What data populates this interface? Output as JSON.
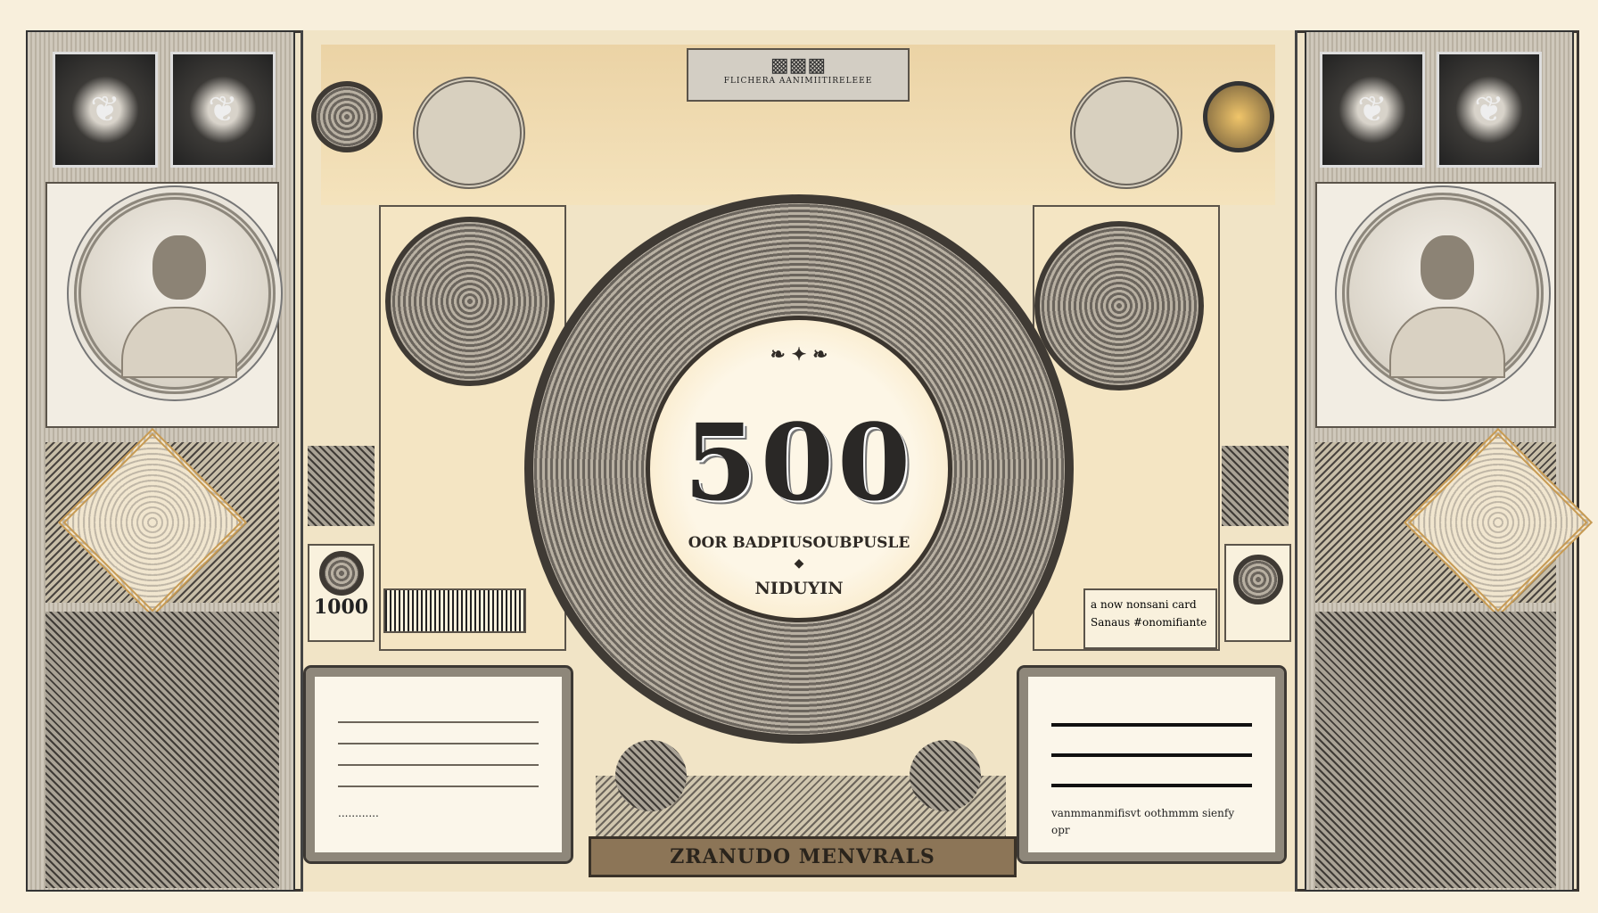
{
  "top_plaque": {
    "caption": "FLICHERA AANIMIITIRELEEE"
  },
  "center_medallion": {
    "denomination": "500",
    "subtitle": "OOR BADPIUSOUBPUSLE",
    "name": "NIDUYIN"
  },
  "left_panel": {
    "denomination": "1000"
  },
  "right_panel": {
    "text_lines": [
      "a now nonsani card",
      "Sanaus #onomifiante"
    ]
  },
  "left_card": {
    "footer_text": "............"
  },
  "right_card": {
    "footer_text": "vanmmanmifisvt oothmmm sienfy opr"
  },
  "bottom_band": {
    "text": "ZRANUDO MENVRALS"
  },
  "colors": {
    "paper": "#f8efdc",
    "gold": "#e6c58a",
    "ink": "#2a2826",
    "frame": "#3a3530"
  }
}
